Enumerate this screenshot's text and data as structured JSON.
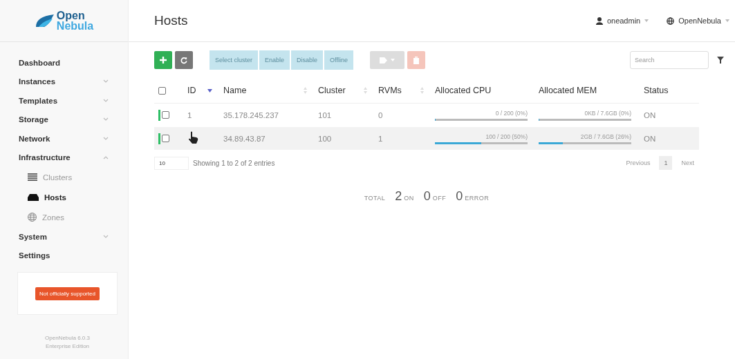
{
  "logo": {
    "line1": "Open",
    "line2": "Nebula"
  },
  "sidebar": {
    "items": [
      {
        "label": "Dashboard"
      },
      {
        "label": "Instances",
        "expanded": false
      },
      {
        "label": "Templates",
        "expanded": false
      },
      {
        "label": "Storage",
        "expanded": false
      },
      {
        "label": "Network",
        "expanded": false
      },
      {
        "label": "Infrastructure",
        "expanded": true,
        "children": [
          {
            "label": "Clusters",
            "selected": false
          },
          {
            "label": "Hosts",
            "selected": true
          },
          {
            "label": "Zones",
            "selected": false
          }
        ]
      },
      {
        "label": "System",
        "expanded": false
      },
      {
        "label": "Settings"
      }
    ],
    "notice": "Not officially supported",
    "version": "OpenNebula 6.0.3",
    "edition": "Enterprise Edition"
  },
  "header": {
    "title": "Hosts",
    "user": "oneadmin",
    "zone": "OpenNebula"
  },
  "toolbar": {
    "actions": [
      {
        "label": "Select cluster",
        "disabled": true
      },
      {
        "label": "Enable",
        "disabled": true
      },
      {
        "label": "Disable",
        "disabled": true
      },
      {
        "label": "Offline",
        "disabled": true
      }
    ],
    "search": {
      "placeholder": "Search"
    }
  },
  "table": {
    "select_all_checked": false,
    "columns": [
      {
        "label": "ID",
        "sorted": true
      },
      {
        "label": "Name",
        "sorted": false
      },
      {
        "label": "Cluster",
        "sorted": false
      },
      {
        "label": "RVMs",
        "sorted": false
      },
      {
        "label": "Allocated CPU"
      },
      {
        "label": "Allocated MEM"
      },
      {
        "label": "Status"
      }
    ],
    "rows": [
      {
        "id": "1",
        "name": "35.178.245.237",
        "cluster": "101",
        "rvms": "0",
        "cpu": {
          "reading": "0 / 200 (0%)",
          "level": 0
        },
        "mem": {
          "reading": "0KB / 7.6GB (0%)",
          "level": 0
        },
        "status": "ON",
        "checked": false,
        "hovered": false
      },
      {
        "name": "34.89.43.87",
        "cluster": "100",
        "rvms": "1",
        "cpu": {
          "reading": "100 / 200 (50%)",
          "level": 0.5
        },
        "mem": {
          "reading": "2GB / 7.6GB (26%)",
          "level": 0.26
        },
        "status": "ON",
        "checked": false,
        "hovered": true
      }
    ]
  },
  "footer": {
    "page_size": "10",
    "info": "Showing 1 to 2 of 2 entries",
    "pagination": [
      {
        "label": "Previous",
        "selected": false
      },
      {
        "label": "1",
        "selected": true
      },
      {
        "label": "Next",
        "selected": false
      }
    ]
  },
  "totals": {
    "label": "TOTAL",
    "items": [
      {
        "count": "2",
        "label": "ON"
      },
      {
        "count": "0",
        "label": "OFF"
      },
      {
        "count": "0",
        "label": "ERROR"
      }
    ]
  }
}
